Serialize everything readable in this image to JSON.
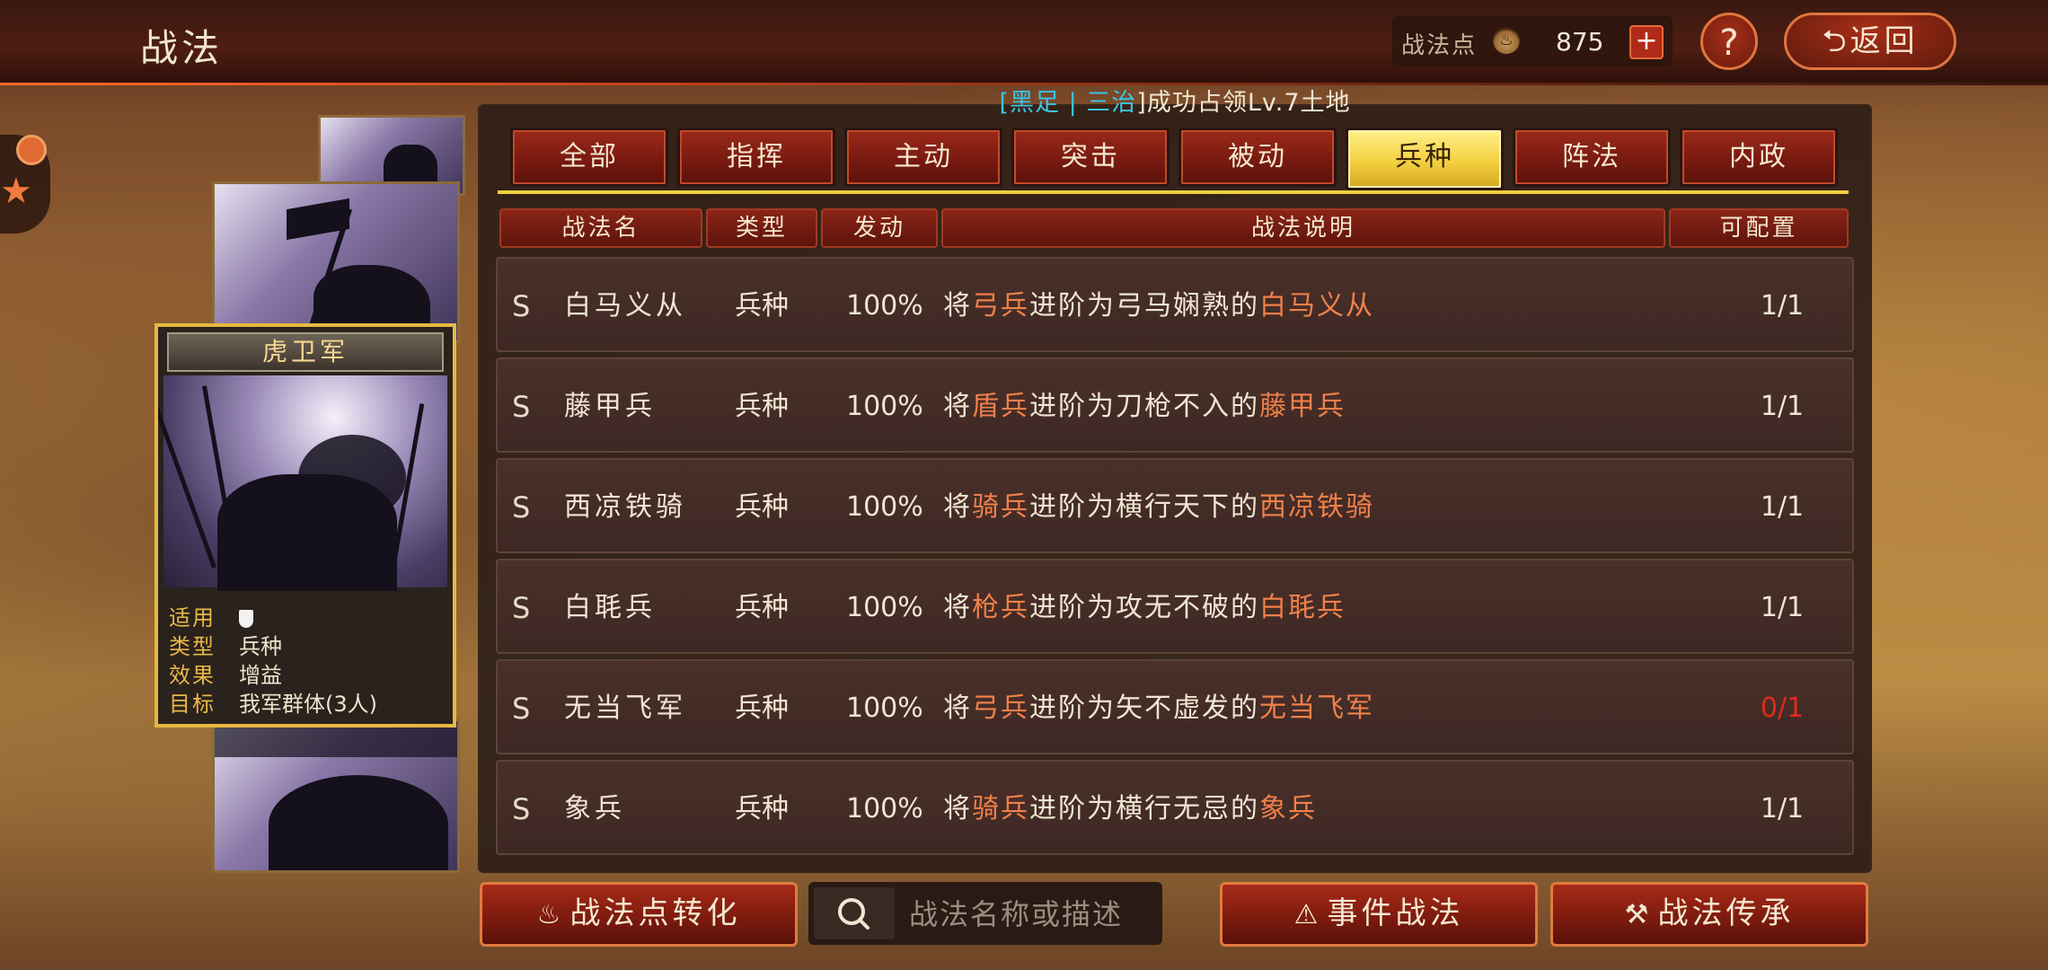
{
  "header": {
    "title": "战法",
    "points_label": "战法点",
    "points_value": "875",
    "plus_label": "+",
    "help_label": "?",
    "back_label": "返回"
  },
  "news": {
    "prefix": "[",
    "alliance": "黑足",
    "sep": " | ",
    "name": "三治",
    "suffix": "]成功占领Lv.7土地"
  },
  "tabs": [
    {
      "label": "全部"
    },
    {
      "label": "指挥"
    },
    {
      "label": "主动"
    },
    {
      "label": "突击"
    },
    {
      "label": "被动"
    },
    {
      "label": "兵种",
      "active": true
    },
    {
      "label": "阵法"
    },
    {
      "label": "内政"
    }
  ],
  "columns": {
    "name": "战法名",
    "type": "类型",
    "rate": "发动",
    "desc": "战法说明",
    "conf": "可配置"
  },
  "rows": [
    {
      "grade": "S",
      "name": "白马义从",
      "type": "兵种",
      "rate": "100%",
      "d1": "将",
      "d2": "弓兵",
      "d3": "进阶为弓马娴熟的",
      "d4": "白马义从",
      "conf": "1/1"
    },
    {
      "grade": "S",
      "name": "藤甲兵",
      "type": "兵种",
      "rate": "100%",
      "d1": "将",
      "d2": "盾兵",
      "d3": "进阶为刀枪不入的",
      "d4": "藤甲兵",
      "conf": "1/1"
    },
    {
      "grade": "S",
      "name": "西凉铁骑",
      "type": "兵种",
      "rate": "100%",
      "d1": "将",
      "d2": "骑兵",
      "d3": "进阶为横行天下的",
      "d4": "西凉铁骑",
      "conf": "1/1"
    },
    {
      "grade": "S",
      "name": "白毦兵",
      "type": "兵种",
      "rate": "100%",
      "d1": "将",
      "d2": "枪兵",
      "d3": "进阶为攻无不破的",
      "d4": "白毦兵",
      "conf": "1/1"
    },
    {
      "grade": "S",
      "name": "无当飞军",
      "type": "兵种",
      "rate": "100%",
      "d1": "将",
      "d2": "弓兵",
      "d3": "进阶为矢不虚发的",
      "d4": "无当飞军",
      "conf": "0/1"
    },
    {
      "grade": "S",
      "name": "象兵",
      "type": "兵种",
      "rate": "100%",
      "d1": "将",
      "d2": "骑兵",
      "d3": "进阶为横行无忌的",
      "d4": "象兵",
      "conf": "1/1"
    }
  ],
  "card": {
    "title": "虎卫军",
    "apply_key": "适用",
    "type_key": "类型",
    "type_val": "兵种",
    "effect_key": "效果",
    "effect_val": "增益",
    "target_key": "目标",
    "target_val": "我军群体(3人)"
  },
  "bottom": {
    "convert_label": "战法点转化",
    "search_placeholder": "战法名称或描述",
    "event_label": "事件战法",
    "inherit_label": "战法传承"
  },
  "colors": {
    "accent_red": "#e02a1a",
    "tab_active": "#f4d040",
    "highlight_orange": "#f0804a",
    "news_cyan": "#39c6e6"
  }
}
